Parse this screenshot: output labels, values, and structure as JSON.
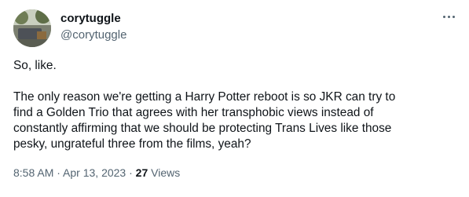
{
  "author": {
    "display_name": "corytuggle",
    "handle": "@corytuggle",
    "avatar_icon": "profile-photo"
  },
  "actions": {
    "more_icon": "more-horizontal-icon"
  },
  "tweet": {
    "paragraph1": "So, like.",
    "paragraph2_lines": [
      "The only reason we're getting a Harry Potter reboot is so JKR can try to",
      "find a Golden Trio that agrees with her transphobic views instead of",
      "constantly affirming that we should be protecting Trans Lives like those",
      "pesky, ungrateful three from the films, yeah?"
    ]
  },
  "meta": {
    "time": "8:58 AM",
    "separator1": " · ",
    "date": "Apr 13, 2023",
    "separator2": " · ",
    "views_count": "27",
    "views_label": " Views"
  },
  "colors": {
    "text": "#0f1419",
    "secondary": "#536471",
    "background": "#ffffff"
  }
}
